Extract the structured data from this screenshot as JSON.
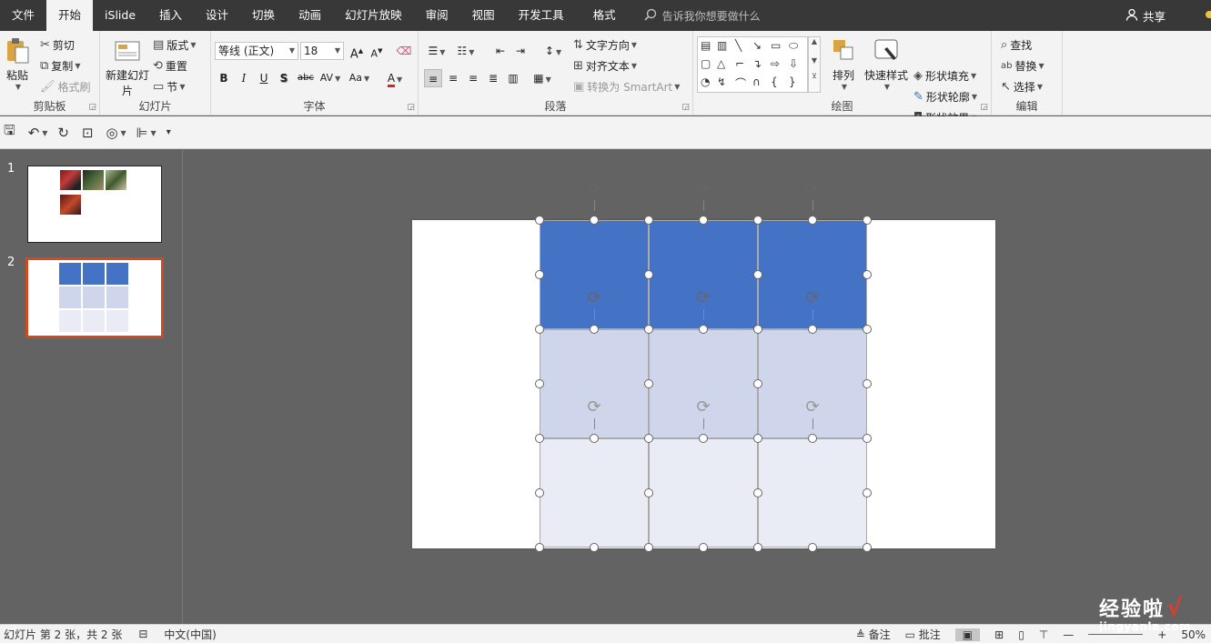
{
  "menu": {
    "tabs": [
      {
        "label": "文件"
      },
      {
        "label": "开始"
      },
      {
        "label": "iSlide"
      },
      {
        "label": "插入"
      },
      {
        "label": "设计"
      },
      {
        "label": "切换"
      },
      {
        "label": "动画"
      },
      {
        "label": "幻灯片放映"
      },
      {
        "label": "审阅"
      },
      {
        "label": "视图"
      },
      {
        "label": "开发工具"
      },
      {
        "label": "格式"
      }
    ],
    "active_tab": "开始",
    "tell_me_placeholder": "告诉我你想要做什么",
    "share_label": "共享"
  },
  "ribbon": {
    "clipboard": {
      "label": "剪贴板",
      "paste": "粘贴",
      "cut": "剪切",
      "copy": "复制",
      "format_painter": "格式刷"
    },
    "slides": {
      "label": "幻灯片",
      "new_slide": "新建幻灯片",
      "layout": "版式",
      "reset": "重置",
      "section": "节"
    },
    "font": {
      "label": "字体",
      "font_name": "等线 (正文)",
      "font_size": "18",
      "bold": "B",
      "italic": "I",
      "underline": "U",
      "shadow": "S",
      "strike": "abc",
      "spacing": "AV",
      "case": "Aa",
      "font_color": "A",
      "grow": "A",
      "shrink": "A"
    },
    "paragraph": {
      "label": "段落",
      "text_direction": "文字方向",
      "align_text": "对齐文本",
      "convert_smartart": "转换为 SmartArt"
    },
    "drawing": {
      "label": "绘图",
      "arrange": "排列",
      "quick_styles": "快速样式",
      "shape_fill": "形状填充",
      "shape_outline": "形状轮廓",
      "shape_effects": "形状效果"
    },
    "editing": {
      "label": "编辑",
      "find": "查找",
      "replace": "替换",
      "select": "选择"
    }
  },
  "thumbnails": [
    {
      "number": "1"
    },
    {
      "number": "2"
    }
  ],
  "slide_grid": {
    "rows": 3,
    "cols": 3,
    "row_colors": [
      "#4472c4",
      "#cfd5ea",
      "#e9ebf5"
    ]
  },
  "status": {
    "slide_info": "幻灯片 第 2 张，共 2 张",
    "language": "中文(中国)",
    "notes": "备注",
    "comments": "批注",
    "zoom": "50%"
  },
  "watermark": {
    "title": "经验啦",
    "check": "√",
    "url": "jingyanla.com"
  },
  "colors": {
    "accent": "#d04a1f",
    "menubar": "#383838",
    "ribbon": "#f3f3f3",
    "workspace": "#636363"
  }
}
